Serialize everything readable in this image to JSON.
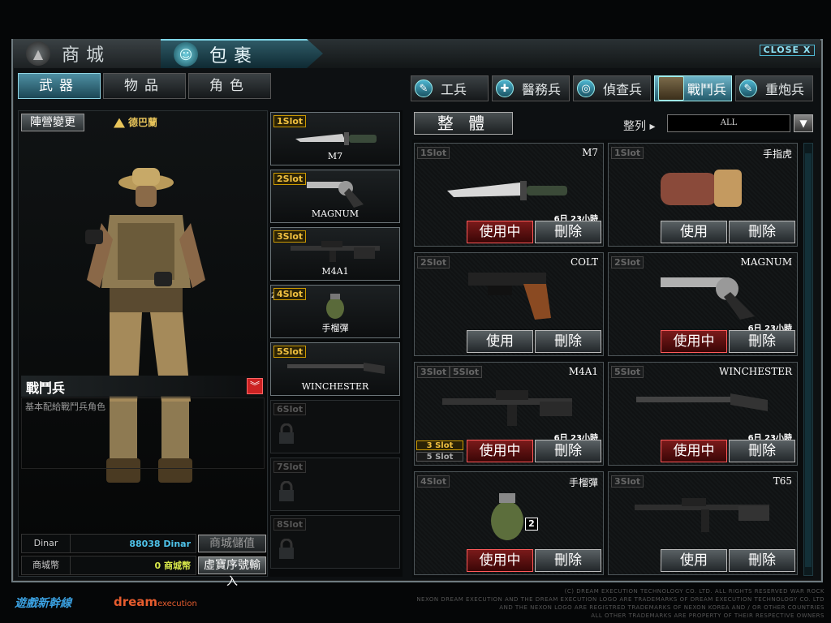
{
  "top_tabs": {
    "shop": "商城",
    "package": "包裹",
    "close": "CLOSE X"
  },
  "sub_tabs": [
    "武器",
    "物品",
    "角色"
  ],
  "class_tabs": [
    {
      "label": "工兵",
      "icon": "wrench-icon"
    },
    {
      "label": "醫務兵",
      "icon": "medic-cross-icon"
    },
    {
      "label": "偵查兵",
      "icon": "crosshair-icon"
    },
    {
      "label": "戰鬥兵",
      "icon": "soldier-portrait-icon"
    },
    {
      "label": "重炮兵",
      "icon": "wrench-icon"
    }
  ],
  "character": {
    "camp_button": "陣營變更",
    "faction": "德巴蘭",
    "class_name": "戰鬥兵",
    "description": "基本配給戰鬥兵角色"
  },
  "currency": {
    "dinar_label": "Dinar",
    "dinar_value": "88038 Dinar",
    "mall_label": "商城幣",
    "mall_value": "0 商城幣",
    "mall_deposit_button": "商城儲值",
    "serial_button": "虛寶序號輸入"
  },
  "slots": [
    {
      "tag": "1Slot",
      "name": "M7"
    },
    {
      "tag": "2Slot",
      "name": "MAGNUM"
    },
    {
      "tag": "3Slot",
      "name": "M4A1"
    },
    {
      "tag": "4Slot",
      "name": "手榴彈",
      "qty": "2"
    },
    {
      "tag": "5Slot",
      "name": "WINCHESTER"
    },
    {
      "tag": "6Slot",
      "name": ""
    },
    {
      "tag": "7Slot",
      "name": ""
    },
    {
      "tag": "8Slot",
      "name": ""
    }
  ],
  "toolbar": {
    "total_button": "整 體",
    "sort_label": "整列 ▸",
    "sort_value": "ALL",
    "sort_arrow": "▼"
  },
  "items": [
    {
      "slot": "1Slot",
      "name": "M7",
      "time": "6日 23小時",
      "use": "使用中",
      "del": "刪除",
      "in_use": true
    },
    {
      "slot": "1Slot",
      "name": "手指虎",
      "time": "",
      "use": "使用",
      "del": "刪除",
      "in_use": false
    },
    {
      "slot": "2Slot",
      "name": "COLT",
      "time": "",
      "use": "使用",
      "del": "刪除",
      "in_use": false
    },
    {
      "slot": "2Slot",
      "name": "MAGNUM",
      "time": "6日 23小時",
      "use": "使用中",
      "del": "刪除",
      "in_use": true
    },
    {
      "slot": "3Slot 5Slot",
      "name": "M4A1",
      "time": "6日 23小時",
      "use": "使用中",
      "del": "刪除",
      "in_use": true,
      "slot_badges": [
        "3 Slot",
        "5 Slot"
      ]
    },
    {
      "slot": "5Slot",
      "name": "WINCHESTER",
      "time": "6日 23小時",
      "use": "使用中",
      "del": "刪除",
      "in_use": true
    },
    {
      "slot": "4Slot",
      "name": "手榴彈",
      "time": "",
      "use": "使用中",
      "del": "刪除",
      "in_use": true,
      "qty": "2"
    },
    {
      "slot": "3Slot",
      "name": "T65",
      "time": "",
      "use": "使用",
      "del": "刪除",
      "in_use": false
    }
  ],
  "footer": {
    "logo1": "遊戲新幹線",
    "logo2": "dream",
    "logo2_small": "execution",
    "copyright": "(C) DREAM EXECUTION TECHNOLOGY CO. LTD. ALL RIGHTS RESERVED WAR ROCK\nNEXON DREAM EXECUTION AND THE DREAM EXECUTION LOGO ARE TRADEMARKS OF DREAM EXECUTION TECHNOLOGY CO. LTD\nAND THE NEXON LOGO ARE REGISTRED TRADEMARKS OF NEXON KOREA AND / OR OTHER COUNTRIES\nALL OTHER TRADEMARKS ARE PROPERTY OF THEIR RESPECTIVE OWNERS"
  }
}
